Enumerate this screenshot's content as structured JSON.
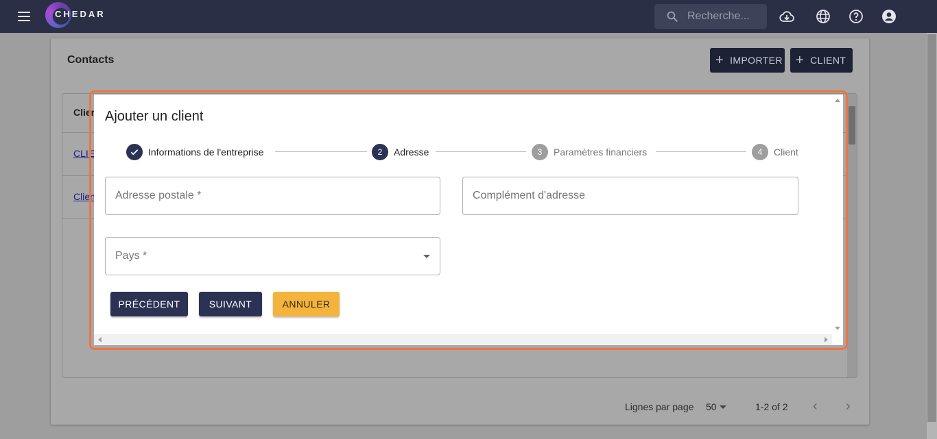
{
  "app": {
    "logo_text": "CHEDAR",
    "search_placeholder": "Recherche..."
  },
  "page": {
    "title": "Contacts",
    "import_label": "IMPORTER",
    "client_label": "CLIENT",
    "table_header": "Clien",
    "rows": [
      "CLIE",
      "Clien"
    ],
    "pagination": {
      "rows_per_page_label": "Lignes par page",
      "rows_per_page_value": "50",
      "range": "1-2 of 2"
    }
  },
  "dialog": {
    "title": "Ajouter un client",
    "steps": [
      {
        "number": "",
        "label": "Informations de l'entreprise",
        "state": "done"
      },
      {
        "number": "2",
        "label": "Adresse",
        "state": "active"
      },
      {
        "number": "3",
        "label": "Paramètres financiers",
        "state": "pending"
      },
      {
        "number": "4",
        "label": "Client",
        "state": "pending"
      }
    ],
    "fields": {
      "address": {
        "placeholder": "Adresse postale *",
        "value": ""
      },
      "complement": {
        "placeholder": "Complément d'adresse",
        "value": ""
      },
      "country": {
        "placeholder": "Pays *",
        "value": ""
      }
    },
    "buttons": {
      "previous": "PRÉCÉDENT",
      "next": "SUIVANT",
      "cancel": "ANNULER"
    }
  },
  "colors": {
    "appbar": "#2b2f45",
    "primary": "#2b3253",
    "accent": "#f3b33c",
    "highlight": "#ee7541"
  }
}
